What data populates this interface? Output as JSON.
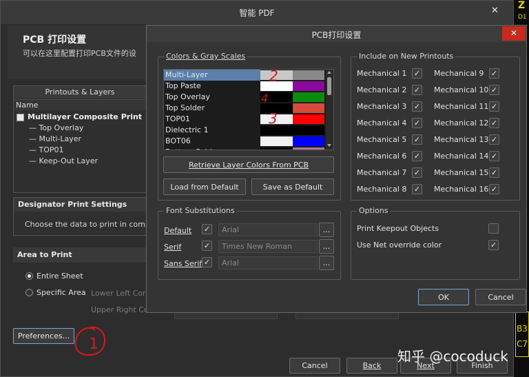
{
  "outer": {
    "title": "智能 PDF",
    "close_glyph": "✕",
    "header_title": "PCB 打印设置",
    "header_sub": "可以在这里配置打印PCB文件的设",
    "printouts_header": "Printouts & Layers",
    "name_column": "Name",
    "tree": {
      "root": "Multilayer Composite Print",
      "children": [
        "Top Overlay",
        "Multi-Layer",
        "TOP01",
        "Keep-Out Layer"
      ]
    },
    "designator_title": "Designator Print Settings",
    "designator_text": "Choose the data to print in compo",
    "area_title": "Area to Print",
    "entire_sheet": "Entire Sheet",
    "specific_area": "Specific Area",
    "lower_left": "Lower Left Corn",
    "upper_right": "Upper Right Co",
    "preferences_btn": "Preferences...",
    "circle_annot": "1",
    "nav": {
      "cancel": "Cancel",
      "back": "Back",
      "next": "Next",
      "finish": "Finish"
    },
    "watermark": "知乎 @cocoduck",
    "edge_text": [
      "Z",
      "D1",
      "B3",
      "C7"
    ]
  },
  "dialog": {
    "title": "PCB打印设置",
    "close_glyph": "✕",
    "colors_group": "Colors & Gray Scales",
    "layers": [
      {
        "name": "Multi-Layer",
        "gray": "#c8c8c8",
        "color": "#8a8a8a",
        "selected": true
      },
      {
        "name": "Top Paste",
        "gray": "#ffffff",
        "color": "#8a0aa0",
        "selected": false
      },
      {
        "name": "Top Overlay",
        "gray": "#000000",
        "color": "#0a8c0a",
        "selected": false
      },
      {
        "name": "Top Solder",
        "gray": "#000000",
        "color": "#d84a3a",
        "selected": false
      },
      {
        "name": "TOP01",
        "gray": "#f0f0f0",
        "color": "#ff0000",
        "selected": false
      },
      {
        "name": "Dielectric 1",
        "gray": "#000000",
        "color": "#000000",
        "selected": false
      },
      {
        "name": "BOT06",
        "gray": "#f0f0f0",
        "color": "#0000ff",
        "selected": false
      },
      {
        "name": "Bottom Solder",
        "gray": "#000000",
        "color": "#a87898",
        "selected": false
      }
    ],
    "annot_marks": [
      "2",
      "4",
      "3"
    ],
    "retrieve_btn": "Retrieve Layer Colors From PCB",
    "load_default_btn": "Load from Default",
    "save_default_btn": "Save as Default",
    "include_group": "Include on New Printouts",
    "mechanical": [
      {
        "label": "Mechanical 1",
        "checked": true
      },
      {
        "label": "Mechanical 2",
        "checked": true
      },
      {
        "label": "Mechanical 3",
        "checked": true
      },
      {
        "label": "Mechanical 4",
        "checked": true
      },
      {
        "label": "Mechanical 5",
        "checked": true
      },
      {
        "label": "Mechanical 6",
        "checked": true
      },
      {
        "label": "Mechanical 7",
        "checked": true
      },
      {
        "label": "Mechanical 8",
        "checked": true
      },
      {
        "label": "Mechanical 9",
        "checked": true
      },
      {
        "label": "Mechanical 10",
        "checked": true
      },
      {
        "label": "Mechanical 11",
        "checked": true
      },
      {
        "label": "Mechanical 12",
        "checked": true
      },
      {
        "label": "Mechanical 13",
        "checked": true
      },
      {
        "label": "Mechanical 14",
        "checked": true
      },
      {
        "label": "Mechanical 15",
        "checked": true
      },
      {
        "label": "Mechanical 16",
        "checked": true
      }
    ],
    "font_group": "Font Substitutions",
    "fonts": [
      {
        "label": "Default",
        "value": "Arial",
        "checked": true
      },
      {
        "label": "Serif",
        "value": "Times New Roman",
        "checked": true
      },
      {
        "label": "Sans Serif",
        "value": "Arial",
        "checked": true
      }
    ],
    "browse_glyph": "...",
    "options_group": "Options",
    "options": [
      {
        "label": "Print Keepout Objects",
        "checked": false
      },
      {
        "label": "Use Net override color",
        "checked": true
      }
    ],
    "ok_btn": "OK",
    "cancel_btn": "Cancel",
    "check_glyph": "✓"
  }
}
